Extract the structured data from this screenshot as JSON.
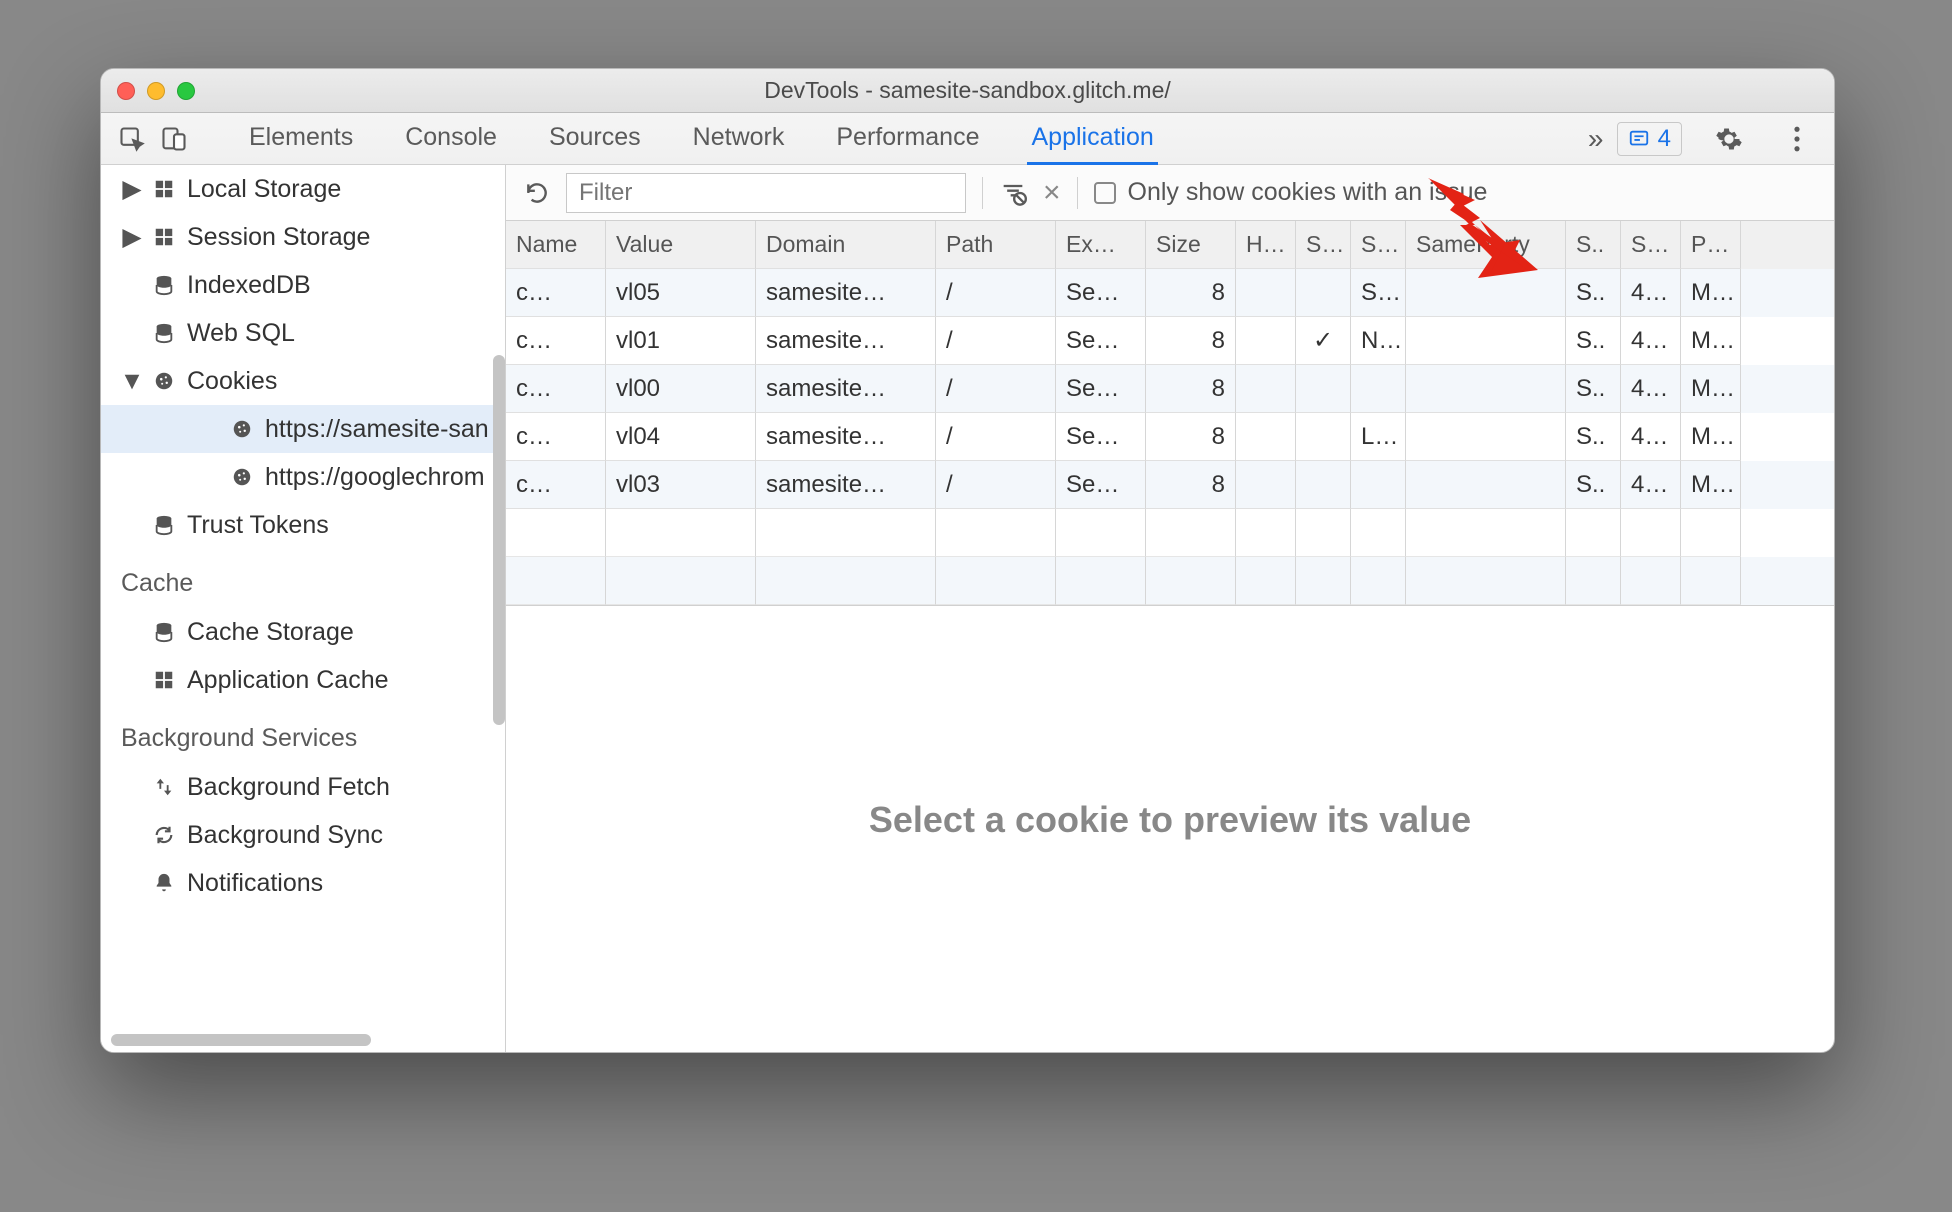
{
  "window": {
    "title": "DevTools - samesite-sandbox.glitch.me/"
  },
  "tabs": {
    "items": [
      "Elements",
      "Console",
      "Sources",
      "Network",
      "Performance",
      "Application"
    ],
    "active_index": 5,
    "overflow_glyph": "»",
    "issues_count": "4"
  },
  "sidebar": {
    "items": [
      {
        "kind": "row",
        "indent": 0,
        "twist": "▶",
        "icon": "grid-icon",
        "label": "Local Storage"
      },
      {
        "kind": "row",
        "indent": 0,
        "twist": "▶",
        "icon": "grid-icon",
        "label": "Session Storage"
      },
      {
        "kind": "row",
        "indent": 0,
        "twist": "",
        "icon": "database-icon",
        "label": "IndexedDB"
      },
      {
        "kind": "row",
        "indent": 0,
        "twist": "",
        "icon": "database-icon",
        "label": "Web SQL"
      },
      {
        "kind": "row",
        "indent": 0,
        "twist": "▼",
        "icon": "cookie-icon",
        "label": "Cookies"
      },
      {
        "kind": "row",
        "indent": 2,
        "twist": "",
        "icon": "cookie-icon",
        "label": "https://samesite-san",
        "selected": true
      },
      {
        "kind": "row",
        "indent": 2,
        "twist": "",
        "icon": "cookie-icon",
        "label": "https://googlechrom"
      },
      {
        "kind": "row",
        "indent": 0,
        "twist": "",
        "icon": "database-icon",
        "label": "Trust Tokens"
      },
      {
        "kind": "section",
        "label": "Cache"
      },
      {
        "kind": "row",
        "indent": 0,
        "twist": "",
        "icon": "database-icon",
        "label": "Cache Storage"
      },
      {
        "kind": "row",
        "indent": 0,
        "twist": "",
        "icon": "grid-icon",
        "label": "Application Cache"
      },
      {
        "kind": "section",
        "label": "Background Services"
      },
      {
        "kind": "row",
        "indent": 0,
        "twist": "",
        "icon": "updown-icon",
        "label": "Background Fetch"
      },
      {
        "kind": "row",
        "indent": 0,
        "twist": "",
        "icon": "sync-icon",
        "label": "Background Sync"
      },
      {
        "kind": "row",
        "indent": 0,
        "twist": "",
        "icon": "bell-icon",
        "label": "Notifications"
      }
    ]
  },
  "toolbar": {
    "filter_placeholder": "Filter",
    "only_issues_label": "Only show cookies with an issue"
  },
  "cookies": {
    "columns": [
      "Name",
      "Value",
      "Domain",
      "Path",
      "Ex…",
      "Size",
      "H…",
      "S…",
      "S…",
      "SameParty",
      "S..",
      "S…",
      "P…"
    ],
    "rows": [
      {
        "name": "c…",
        "value": "vl05",
        "domain": "samesite…",
        "path": "/",
        "expires": "Se…",
        "size": "8",
        "http": "",
        "secure": "",
        "samesite": "S…",
        "sameparty": "",
        "scheme": "S..",
        "port": "4…",
        "priority": "M…"
      },
      {
        "name": "c…",
        "value": "vl01",
        "domain": "samesite…",
        "path": "/",
        "expires": "Se…",
        "size": "8",
        "http": "",
        "secure": "✓",
        "samesite": "N…",
        "sameparty": "",
        "scheme": "S..",
        "port": "4…",
        "priority": "M…"
      },
      {
        "name": "c…",
        "value": "vl00",
        "domain": "samesite…",
        "path": "/",
        "expires": "Se…",
        "size": "8",
        "http": "",
        "secure": "",
        "samesite": "",
        "sameparty": "",
        "scheme": "S..",
        "port": "4…",
        "priority": "M…"
      },
      {
        "name": "c…",
        "value": "vl04",
        "domain": "samesite…",
        "path": "/",
        "expires": "Se…",
        "size": "8",
        "http": "",
        "secure": "",
        "samesite": "L…",
        "sameparty": "",
        "scheme": "S..",
        "port": "4…",
        "priority": "M…"
      },
      {
        "name": "c…",
        "value": "vl03",
        "domain": "samesite…",
        "path": "/",
        "expires": "Se…",
        "size": "8",
        "http": "",
        "secure": "",
        "samesite": "",
        "sameparty": "",
        "scheme": "S..",
        "port": "4…",
        "priority": "M…"
      }
    ],
    "empty_rows": 2
  },
  "preview": {
    "placeholder": "Select a cookie to preview its value"
  },
  "colors": {
    "accent": "#1a73e8",
    "arrow": "#e32315"
  }
}
